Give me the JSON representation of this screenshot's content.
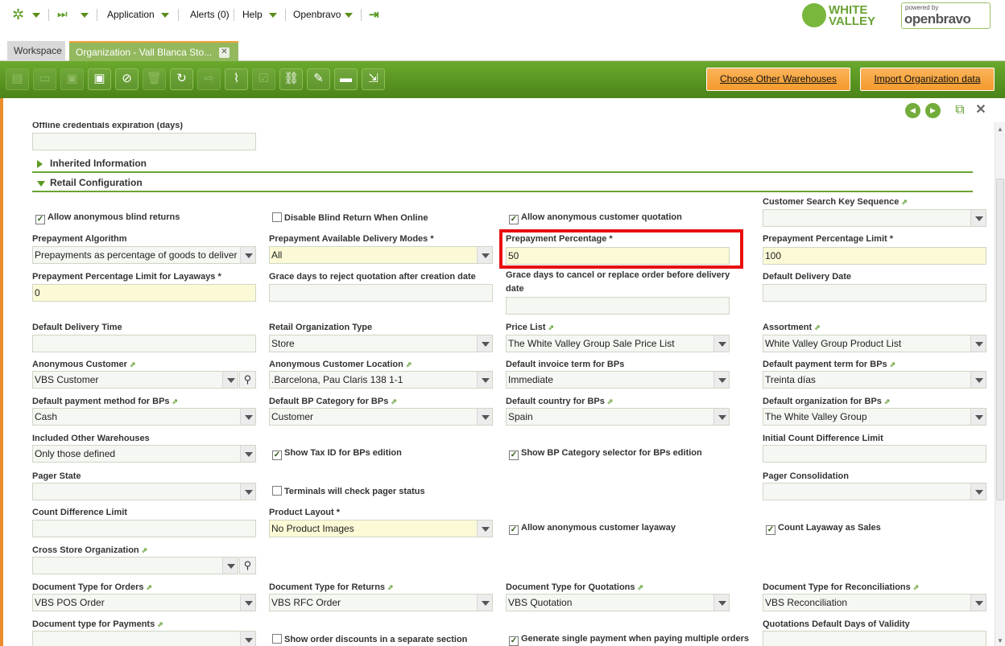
{
  "topbar": {
    "menu": [
      "Application",
      "Alerts (0)",
      "Help",
      "Openbravo"
    ],
    "logo_whitevalley": [
      "WHITE",
      "VALLEY"
    ],
    "logo_poweredby": "powered by",
    "logo_openbravo": "openbravo"
  },
  "tabs": {
    "workspace": "Workspace",
    "active": "Organization - Vall Blanca Sto...",
    "close": "✕"
  },
  "toolbar": {
    "buttons": [
      "new-document",
      "new-row",
      "save",
      "save-close",
      "undo",
      "delete",
      "refresh",
      "export",
      "attachment",
      "process",
      "link",
      "tools",
      "grid-form-toggle",
      "print"
    ],
    "choose_warehouses": "Choose Other Warehouses",
    "import_org": "Import Organization data"
  },
  "form": {
    "offline_label": "Offline credentials expiration (days)",
    "section_inherited": "Inherited Information",
    "section_retail": "Retail Configuration",
    "customer_search_key": "Customer Search Key Sequence",
    "allow_anon_blind": "Allow anonymous blind returns",
    "disable_blind_online": "Disable Blind Return When Online",
    "allow_anon_quotation": "Allow anonymous customer quotation",
    "prepayment_algorithm": {
      "label": "Prepayment Algorithm",
      "value": "Prepayments as percentage of goods to deliver"
    },
    "prepayment_modes": {
      "label": "Prepayment Available Delivery Modes *",
      "value": "All"
    },
    "prepayment_pct": {
      "label": "Prepayment Percentage *",
      "value": "50"
    },
    "prepayment_pct_limit": {
      "label": "Prepayment Percentage Limit *",
      "value": "100"
    },
    "prepayment_layaway": {
      "label": "Prepayment Percentage Limit for Layaways *",
      "value": "0"
    },
    "grace_reject": "Grace days to reject quotation after creation date",
    "grace_cancel": "Grace days to cancel or replace order before delivery date",
    "default_delivery_date": "Default Delivery Date",
    "default_delivery_time": "Default Delivery Time",
    "retail_org_type": {
      "label": "Retail Organization Type",
      "value": "Store"
    },
    "price_list": {
      "label": "Price List",
      "value": "The White Valley Group Sale Price List"
    },
    "assortment": {
      "label": "Assortment",
      "value": "White Valley Group Product List"
    },
    "anon_customer": {
      "label": "Anonymous Customer",
      "value": "VBS Customer"
    },
    "anon_location": {
      "label": "Anonymous Customer Location",
      "value": ".Barcelona, Pau Claris 138 1-1"
    },
    "invoice_term": {
      "label": "Default invoice term for BPs",
      "value": "Immediate"
    },
    "payment_term": {
      "label": "Default payment term for BPs",
      "value": "Treinta días"
    },
    "payment_method": {
      "label": "Default payment method for BPs",
      "value": "Cash"
    },
    "bp_category": {
      "label": "Default BP Category for BPs",
      "value": "Customer"
    },
    "country": {
      "label": "Default country for BPs",
      "value": "Spain"
    },
    "org_bps": {
      "label": "Default organization for BPs",
      "value": "The White Valley Group"
    },
    "included_wh": {
      "label": "Included Other Warehouses",
      "value": "Only those defined"
    },
    "show_tax_id": "Show Tax ID for BPs edition",
    "show_bp_category": "Show BP Category selector for BPs edition",
    "initial_count_diff": "Initial Count Difference Limit",
    "pager_state": "Pager State",
    "terminals_pager": "Terminals will check pager status",
    "pager_consolidation": "Pager Consolidation",
    "count_diff_limit": "Count Difference Limit",
    "product_layout": {
      "label": "Product Layout *",
      "value": "No Product Images"
    },
    "allow_anon_layaway": "Allow anonymous customer layaway",
    "count_layaway_sales": "Count Layaway as Sales",
    "cross_store_org": "Cross Store Organization",
    "doc_orders": {
      "label": "Document Type for Orders",
      "value": "VBS POS Order"
    },
    "doc_returns": {
      "label": "Document Type for Returns",
      "value": "VBS RFC Order"
    },
    "doc_quotations": {
      "label": "Document Type for Quotations",
      "value": "VBS Quotation"
    },
    "doc_reconciliations": {
      "label": "Document Type for Reconciliations",
      "value": "VBS Reconciliation"
    },
    "doc_payments": "Document type for Payments",
    "show_discounts": "Show order discounts in a separate section",
    "single_payment": "Generate single payment when paying multiple orders",
    "quot_validity": "Quotations Default Days of Validity"
  },
  "colors": {
    "accent_green": "#5a9a22",
    "highlight_red": "#e80f0f",
    "required_yellow": "#fcfad6",
    "orange_button": "#f3a33a"
  }
}
